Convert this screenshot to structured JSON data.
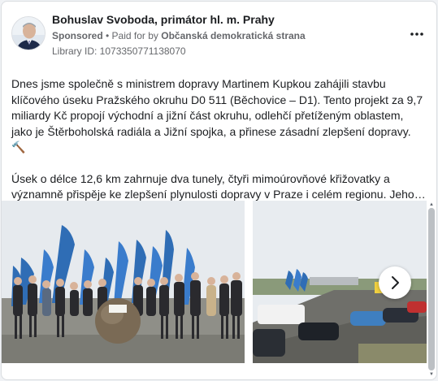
{
  "ad": {
    "page_name": "Bohuslav Svoboda, primátor hl. m. Prahy",
    "sponsored": "Sponsored",
    "separator": " • ",
    "paid_for_prefix": "Paid for by ",
    "payer": "Občanská demokratická strana",
    "library_id": "Library ID: 1073350771138070",
    "more_icon": "more-horizontal-icon"
  },
  "post": {
    "paragraph_1": "Dnes jsme společně s ministrem dopravy Martinem Kupkou zahájili stavbu klíčového úseku Pražského okruhu D0 511 (Běchovice – D1). Tento projekt za 9,7 miliardy Kč propojí východní a jižní část okruhu, odlehčí přetíženým oblastem, jako je Štěrboholská radiála a Jižní spojka, a přinese zásadní zlepšení dopravy. 🔨",
    "paragraph_2": "Úsek o délce 12,6 km zahrnuje dva tunely, čtyři mimoúrovňové křižovatky a významně přispěje ke zlepšení plynulosti dopravy v Praze i celém regionu. Jeho…"
  },
  "carousel": {
    "next_icon": "chevron-right-icon",
    "photos": [
      "ceremony-photo",
      "highway-photo"
    ]
  },
  "colors": {
    "flag_blue": "#2f6db5",
    "flag_white": "#ffffff",
    "sky": "#e9edf1",
    "text_primary": "#1c1e21",
    "text_secondary": "#65676b"
  }
}
